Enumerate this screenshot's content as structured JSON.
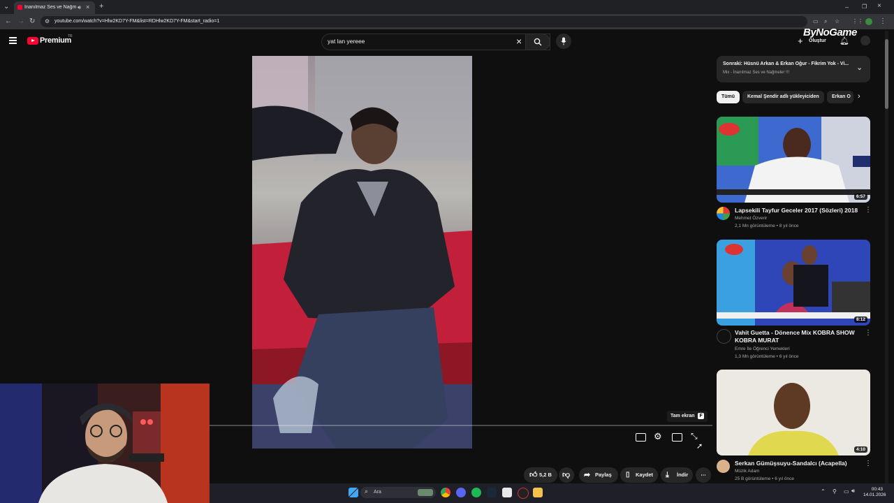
{
  "browser": {
    "tab_title": "İnanılmaz Ses ve Nağmeler",
    "url": "youtube.com/watch?v=Hlw2KD7Y-FM&list=RDHlw2KD7Y-FM&start_radio=1",
    "new_tab_icon": "plus-icon"
  },
  "header": {
    "logo": "Premium",
    "logo_region": "TR",
    "search_value": "yat lan yereee",
    "create_label": "Oluştur"
  },
  "overlay_logo": "ByNoGame",
  "player": {
    "fullscreen_tooltip": "Tam ekran",
    "fullscreen_key": "F"
  },
  "up_next": {
    "title": "Sonraki: Hüsnü Arkan & Erkan Oğur - Fikrim Yok - Vi...",
    "subtitle": "Mix - İnanılmaz Ses ve Nağmeler !!!"
  },
  "chips": [
    "Tümü",
    "Kemal Şendir adlı yükleyiciden",
    "Erkan O"
  ],
  "recommendations": [
    {
      "title": "Lapsekili Tayfur Geceler 2017 (Sözleri) 2018",
      "channel": "Mehmet Özverir",
      "stats": "2,1 Mn görüntüleme • 8 yıl önce",
      "duration": "6:57",
      "accent": "#3a6fd8"
    },
    {
      "title": "Vahit Guetta - Dönence Mix KOBRA SHOW KOBRA MURAT",
      "channel": "Emre İle Öğrenci Yemekleri",
      "stats": "1,3 Mn görüntüleme • 6 yıl önce",
      "duration": "8:12",
      "accent": "#2c3d9a"
    },
    {
      "title": "Serkan Gümüşsuyu-Sandalcı (Acapella)",
      "channel": "Müzik Adam",
      "stats": "25 B görüntüleme • 6 yıl önce",
      "duration": "4:10",
      "accent": "#e9e6df"
    }
  ],
  "actions": {
    "likes": "5,2 B",
    "share": "Paylaş",
    "save": "Kaydet",
    "download": "İndir"
  },
  "taskbar": {
    "search_placeholder": "Ara",
    "time": "00:43",
    "date": "14.01.2026"
  }
}
